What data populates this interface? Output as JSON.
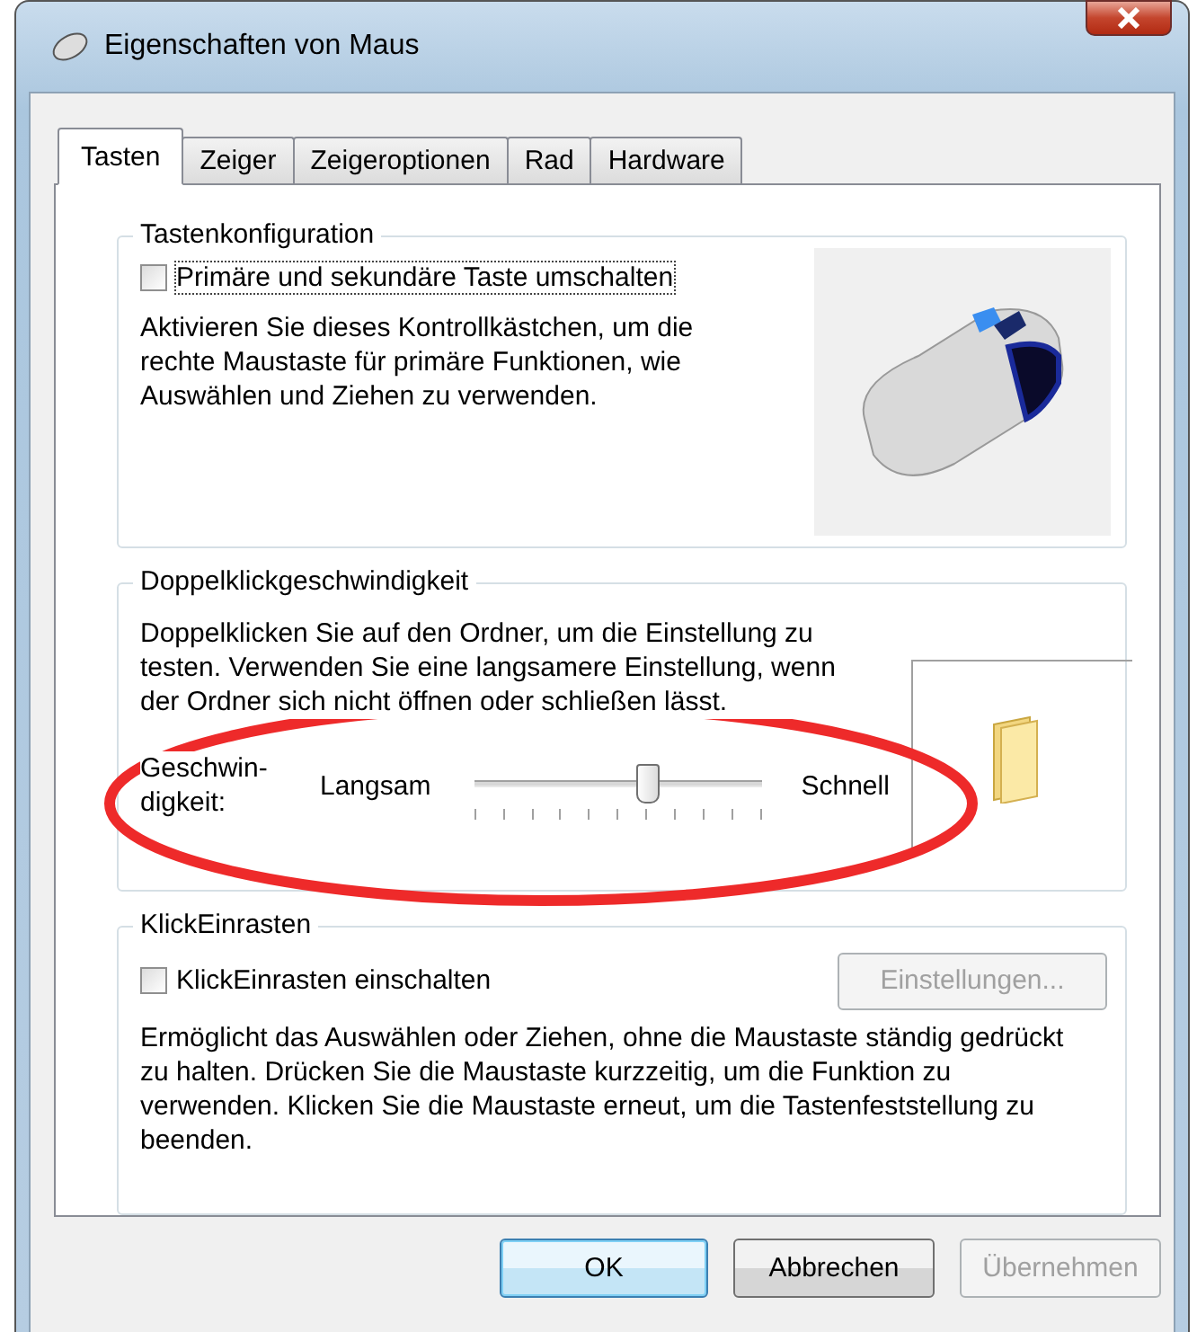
{
  "window": {
    "title": "Eigenschaften von Maus"
  },
  "tabs": [
    {
      "label": "Tasten",
      "selected": true
    },
    {
      "label": "Zeiger",
      "selected": false
    },
    {
      "label": "Zeigeroptionen",
      "selected": false
    },
    {
      "label": "Rad",
      "selected": false
    },
    {
      "label": "Hardware",
      "selected": false
    }
  ],
  "button_config": {
    "title": "Tastenkonfiguration",
    "checkbox": {
      "label": "Primäre und sekundäre Taste umschalten",
      "checked": false
    },
    "description": "Aktivieren Sie dieses Kontrollkästchen, um die rechte Maustaste für primäre Funktionen, wie Auswählen und Ziehen zu verwenden."
  },
  "double_click": {
    "title": "Doppelklickgeschwindigkeit",
    "description": "Doppelklicken Sie auf den Ordner, um die Einstellung zu testen. Verwenden Sie eine langsamere Einstellung, wenn der Ordner sich nicht öffnen oder schließen lässt.",
    "speed_label": "Geschwin-digkeit:",
    "slider": {
      "min_label": "Langsam",
      "max_label": "Schnell",
      "level": 0.6
    }
  },
  "click_lock": {
    "title": "KlickEinrasten",
    "checkbox": {
      "label": "KlickEinrasten einschalten",
      "checked": false
    },
    "settings_button": {
      "label": "Einstellungen...",
      "disabled": true
    },
    "description": "Ermöglicht das Auswählen oder Ziehen, ohne die Maustaste ständig gedrückt zu halten. Drücken Sie die Maustaste kurzzeitig, um die Funktion zu verwenden. Klicken Sie die Maustaste erneut, um die Tastenfeststellung zu beenden."
  },
  "buttons": [
    {
      "label": "OK",
      "disabled": false,
      "default": true
    },
    {
      "label": "Abbrechen",
      "disabled": false,
      "default": false
    },
    {
      "label": "Übernehmen",
      "disabled": true,
      "default": false
    }
  ]
}
